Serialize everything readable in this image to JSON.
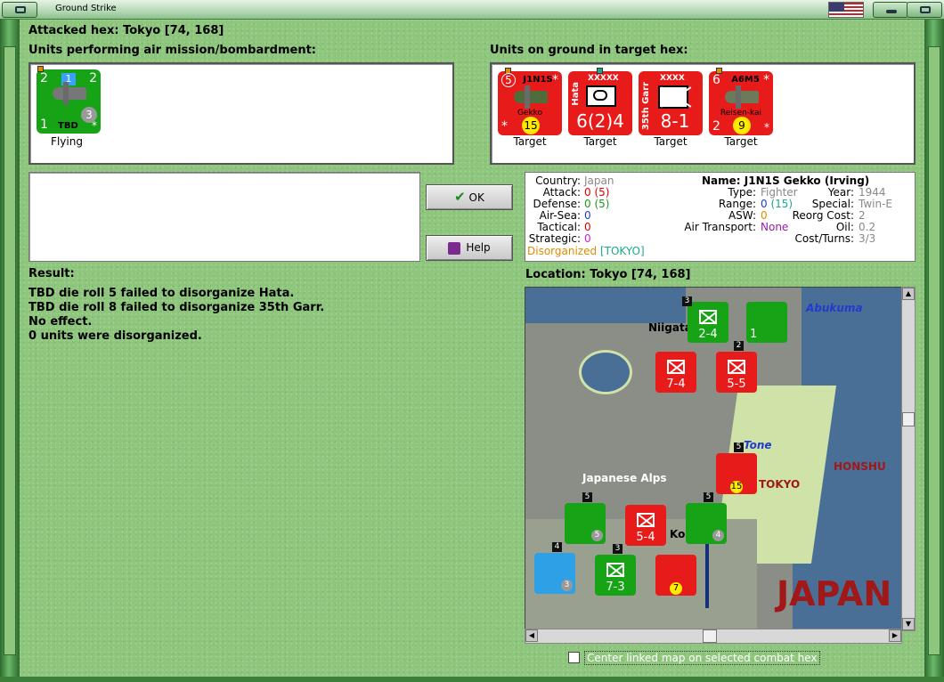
{
  "window": {
    "title": "Ground Strike",
    "flag": "USA"
  },
  "attacked_hex": "Attacked hex: Tokyo  [74, 168]",
  "air_units_label": "Units performing air mission/bombardment:",
  "ground_units_label": "Units on ground in target hex:",
  "air_units": [
    {
      "name": "TBD",
      "top_left": "2",
      "top_right": "2",
      "badge": "1",
      "circle": "3",
      "bottom_left": "1",
      "star": "*",
      "status": "Flying"
    }
  ],
  "ground_units": [
    {
      "name": "J1N1S",
      "sub": "Gekko",
      "top_left": "5",
      "top_right": "*",
      "yellow": "15",
      "star": "*",
      "status": "Target"
    },
    {
      "name": "Hata",
      "size": "XXXXX",
      "value": "6(2)4",
      "status": "Target"
    },
    {
      "name": "35th Garr",
      "size": "XXXX",
      "value": "8-1",
      "status": "Target"
    },
    {
      "name": "A6M5",
      "sub": "Reisen-kai",
      "top_left": "6",
      "top_right": "*",
      "bottom_left": "2",
      "yellow": "9",
      "star": "*",
      "status": "Target"
    }
  ],
  "buttons": {
    "ok": "OK",
    "help": "Help"
  },
  "info": {
    "country_label": "Country:",
    "country": "Japan",
    "attack_label": "Attack:",
    "attack": "0",
    "attack_paren": "(5)",
    "defense_label": "Defense:",
    "defense": "0",
    "defense_paren": "(5)",
    "airsea_label": "Air-Sea:",
    "airsea": "0",
    "tactical_label": "Tactical:",
    "tactical": "0",
    "strategic_label": "Strategic:",
    "strategic": "0",
    "status": "Disorganized",
    "status_loc": "[TOKYO]",
    "name_label": "Name:",
    "name": "J1N1S Gekko (Irving)",
    "type_label": "Type:",
    "type": "Fighter",
    "range_label": "Range:",
    "range": "0",
    "range_paren": "(15)",
    "asw_label": "ASW:",
    "asw": "0",
    "air_transport_label": "Air Transport:",
    "air_transport": "None",
    "year_label": "Year:",
    "year": "1944",
    "special_label": "Special:",
    "special": "Twin-E",
    "reorg_label": "Reorg Cost:",
    "reorg": "2",
    "oil_label": "Oil:",
    "oil": "0.2",
    "cost_label": "Cost/Turns:",
    "cost": "3/3"
  },
  "result": {
    "label": "Result:",
    "lines": [
      "TBD die roll 5 failed to disorganize Hata.",
      "TBD die roll 8 failed to disorganize 35th Garr.",
      "No effect.",
      "0 units were disorganized."
    ]
  },
  "location": "Location:  Tokyo  [74, 168]",
  "map": {
    "labels": [
      "Niigata",
      "Abukuma",
      "Tone",
      "HONSHU",
      "Japanese Alps",
      "TOKYO",
      "JAPAN",
      "Ko"
    ],
    "units": [
      {
        "kind": "green",
        "value": "2-4",
        "tag": "3"
      },
      {
        "kind": "green",
        "value": "1",
        "tag": ""
      },
      {
        "kind": "red",
        "value": "7-4",
        "tag": ""
      },
      {
        "kind": "red",
        "value": "5-5",
        "tag": "2"
      },
      {
        "kind": "red",
        "value": "15",
        "tag": "5"
      },
      {
        "kind": "green",
        "value": "5",
        "tag": "5"
      },
      {
        "kind": "red",
        "value": "5-4",
        "tag": ""
      },
      {
        "kind": "green",
        "value": "4",
        "tag": "5"
      },
      {
        "kind": "cyan",
        "value": "3",
        "tag": "4"
      },
      {
        "kind": "green",
        "value": "7-3",
        "tag": "3"
      },
      {
        "kind": "red",
        "value": "7",
        "tag": ""
      }
    ]
  },
  "checkbox": {
    "label": "Center linked map on selected combat hex",
    "checked": false
  },
  "colors": {
    "background": "#8fc67d",
    "red_unit": "#e81b1b",
    "green_unit": "#16a316"
  }
}
